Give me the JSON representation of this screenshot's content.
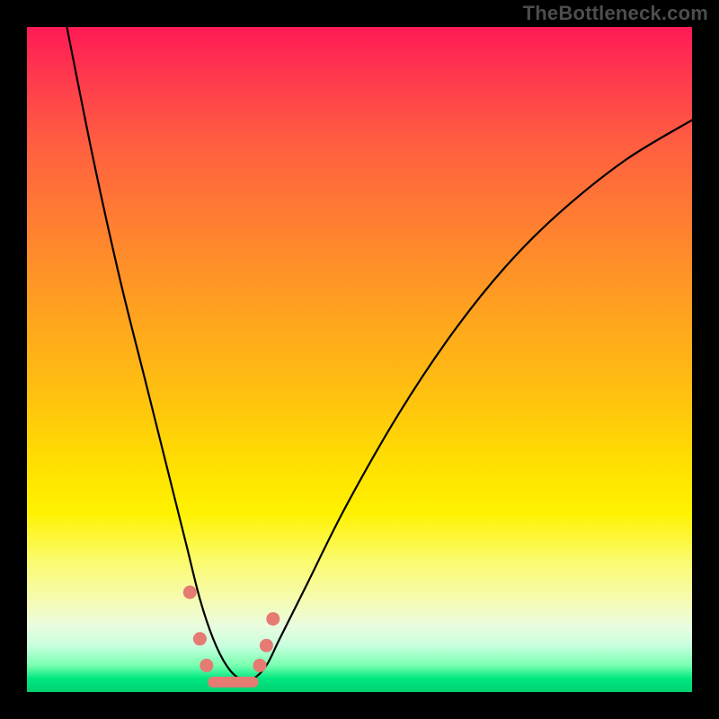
{
  "watermark": "TheBottleneck.com",
  "chart_data": {
    "type": "line",
    "title": "",
    "xlabel": "",
    "ylabel": "",
    "xlim": [
      0,
      100
    ],
    "ylim": [
      0,
      100
    ],
    "series": [
      {
        "name": "bottleneck-curve",
        "x": [
          6,
          10,
          14,
          18,
          22,
          24,
          26,
          28,
          30,
          32,
          34,
          36,
          38,
          42,
          48,
          56,
          64,
          72,
          80,
          90,
          100
        ],
        "values": [
          100,
          80,
          62,
          46,
          30,
          22,
          14,
          8,
          4,
          2,
          2,
          4,
          8,
          16,
          28,
          42,
          54,
          64,
          72,
          80,
          86
        ]
      }
    ],
    "markers": [
      {
        "x": 24.5,
        "y": 15
      },
      {
        "x": 26.0,
        "y": 8
      },
      {
        "x": 27.0,
        "y": 4
      },
      {
        "x": 35.0,
        "y": 4
      },
      {
        "x": 36.0,
        "y": 7
      },
      {
        "x": 37.0,
        "y": 11
      }
    ],
    "flat_segment": {
      "x0": 28,
      "x1": 34,
      "y": 1.5
    },
    "colors": {
      "curve": "#000000",
      "marker": "#e57b73",
      "gradient_top": "#ff1a55",
      "gradient_bottom": "#00d070"
    }
  }
}
